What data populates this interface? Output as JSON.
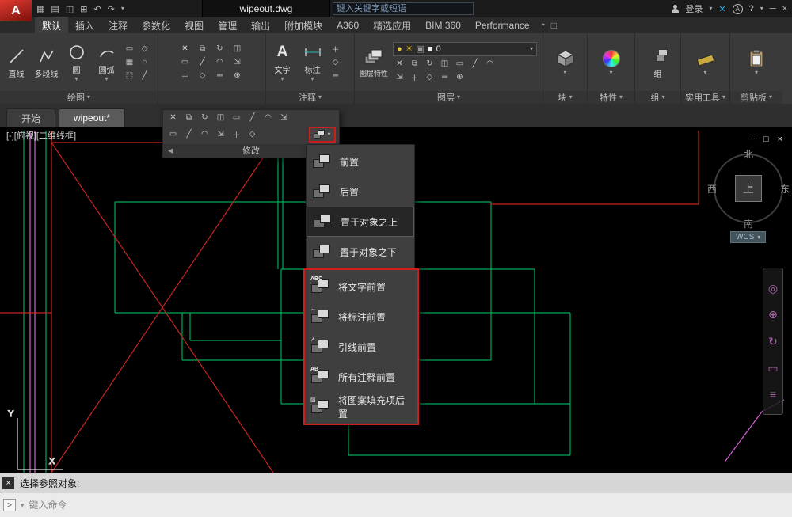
{
  "titlebar": {
    "doc_title": "wipeout.dwg",
    "search_placeholder": "键入关键字或短语",
    "login_label": "登录",
    "help_label": "?"
  },
  "ribbon": {
    "tabs": [
      "默认",
      "插入",
      "注释",
      "参数化",
      "视图",
      "管理",
      "输出",
      "附加模块",
      "A360",
      "精选应用",
      "BIM 360",
      "Performance"
    ],
    "panels": {
      "draw": {
        "label": "绘图",
        "tools": [
          "直线",
          "多段线",
          "圆",
          "圆弧"
        ]
      },
      "modify": {
        "label": "修改"
      },
      "annotate": {
        "label": "注释",
        "text_tool": "文字",
        "dim_tool": "标注"
      },
      "layers": {
        "label": "图层",
        "properties_tool": "图层特性",
        "current_layer": "0"
      },
      "block": {
        "label": "块"
      },
      "properties": {
        "label": "特性"
      },
      "group": {
        "label": "组",
        "group_tool": "组"
      },
      "utilities": {
        "label": "实用工具"
      },
      "clipboard": {
        "label": "剪贴板"
      }
    }
  },
  "file_tabs": {
    "start": "开始",
    "drawing": "wipeout*"
  },
  "dropdown_menu": {
    "selected_item": "置于对象之上",
    "items": [
      {
        "label": "前置"
      },
      {
        "label": "后置"
      },
      {
        "label": "置于对象之上"
      },
      {
        "label": "置于对象之下"
      }
    ],
    "annotation_items": [
      {
        "label": "将文字前置",
        "mark": "ABC"
      },
      {
        "label": "将标注前置",
        "mark": "↔"
      },
      {
        "label": "引线前置",
        "mark": "↗"
      },
      {
        "label": "所有注释前置",
        "mark": "AB"
      },
      {
        "label": "将图案填充项后置",
        "mark": "▨"
      }
    ]
  },
  "viewport": {
    "label": "[-][俯视][二维线框]",
    "viewcube": {
      "north": "北",
      "south": "南",
      "west": "西",
      "east": "东",
      "top": "上"
    },
    "wcs_label": "WCS",
    "axis_x": "X",
    "axis_y": "Y"
  },
  "command": {
    "prompt": "选择参照对象:",
    "input_placeholder": "键入命令"
  },
  "icons": {
    "caret_down": "▾",
    "close": "×",
    "minimize": "─",
    "restore": "□",
    "pin_left": "◀",
    "prompt_arrow": ">",
    "x_logo": "✕",
    "a_logo": "A",
    "tool_glyphs": [
      "✕",
      "⧉",
      "↻",
      "◫",
      "▭",
      "╱",
      "◠",
      "⇲",
      "＋",
      "◇",
      "═",
      "⊕"
    ],
    "draw_glyphs": [
      "▭",
      "◇",
      "▦",
      "○",
      "⬚",
      "╱"
    ],
    "nav_glyphs": [
      "◎",
      "⊕",
      "↻",
      "▭",
      "≡"
    ],
    "qat_glyphs": [
      "▦",
      "▤",
      "◫",
      "⊞",
      "↶",
      "↷",
      "▾"
    ],
    "layer_status": [
      "●",
      "☀",
      "▣",
      "■"
    ]
  },
  "colors": {
    "line_green": "#00a85a",
    "line_red": "#c9251f",
    "line_magenta": "#d65fd6",
    "highlight_red": "#cf1d1d",
    "accent_blue": "#2aa8e0",
    "nav_icon": "#b06ab0"
  }
}
